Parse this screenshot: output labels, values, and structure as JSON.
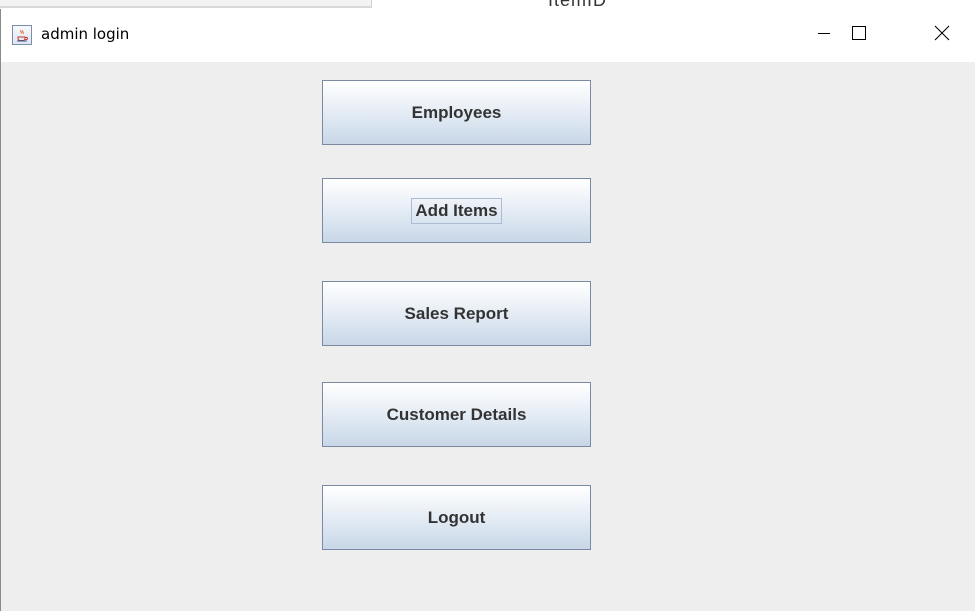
{
  "background_window": {
    "partial_text": "ItemID"
  },
  "window": {
    "title": "admin login",
    "app_icon": "java-cup-icon",
    "controls": {
      "minimize": "minimize-icon",
      "maximize": "maximize-icon",
      "close": "close-icon"
    }
  },
  "menu": {
    "buttons": [
      {
        "label": "Employees",
        "focused": false
      },
      {
        "label": "Add Items",
        "focused": true
      },
      {
        "label": "Sales Report",
        "focused": false
      },
      {
        "label": "Customer Details",
        "focused": false
      },
      {
        "label": "Logout",
        "focused": false
      }
    ]
  },
  "colors": {
    "window_bg": "#eeeeee",
    "titlebar_bg": "#ffffff",
    "button_border": "#7a8aa0",
    "button_text": "#333333",
    "focus_ring": "#a9bcd3"
  }
}
